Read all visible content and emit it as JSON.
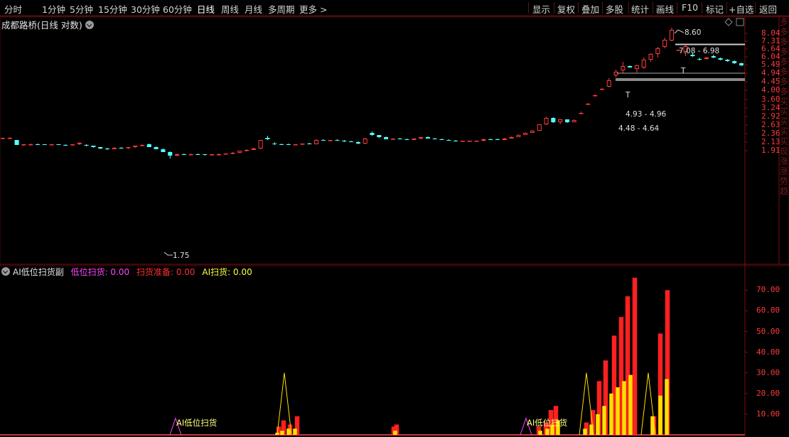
{
  "toolbar": {
    "periods": [
      "分时",
      "1分钟",
      "5分钟",
      "15分钟",
      "30分钟",
      "60分钟",
      "日线",
      "周线",
      "月线",
      "多周期",
      "更多 >"
    ],
    "active_index": 6,
    "right_buttons": [
      "显示",
      "复权",
      "叠加",
      "多股",
      "统计",
      "画线",
      "F10",
      "标记",
      "+自选",
      "返回"
    ]
  },
  "main": {
    "title": "成都路桥(日线 对数)",
    "price_ticks": [
      "8.04",
      "7.31",
      "6.64",
      "6.04",
      "5.49",
      "4.94",
      "4.45",
      "4.00",
      "3.60",
      "3.24",
      "2.92",
      "2.63",
      "2.36",
      "2.13",
      "1.91"
    ],
    "annotations": {
      "high": "8.60",
      "low": "1.75",
      "zone1": "7.08 - 6.98",
      "zone2": "4.93 - 4.96",
      "zone3": "4.48 - 4.64",
      "t1": "T",
      "t2": "T"
    }
  },
  "indicator": {
    "name": "AI低位扫货副",
    "labels": [
      {
        "text": "低位扫货: 0.00",
        "color": "#ff44ff"
      },
      {
        "text": "扫货准备: 0.00",
        "color": "#ff3030"
      },
      {
        "text": "AI扫货: 0.00",
        "color": "#ffff40"
      }
    ],
    "ticks": [
      "70.00",
      "60.00",
      "50.00",
      "40.00",
      "30.00",
      "20.00",
      "10.00"
    ],
    "markers": [
      "AI低位扫货",
      "AI低位扫货"
    ]
  },
  "sidebar_chars": "多多多多多多多多买买买买买现涨涨势趋",
  "colors": {
    "up": "#ff3b3b",
    "down": "#54ffff",
    "grid": "#7a1010",
    "yellow": "#ffe000",
    "red_bar": "#ff2020",
    "magenta": "#ff44ff"
  },
  "chart_data": {
    "type": "candlestick",
    "candles": [
      [
        2.22,
        2.25,
        2.2,
        2.24
      ],
      [
        2.24,
        2.26,
        2.23,
        2.25
      ],
      [
        2.18,
        2.19,
        2.05,
        2.06
      ],
      [
        2.06,
        2.08,
        2.04,
        2.07
      ],
      [
        2.07,
        2.09,
        2.05,
        2.08
      ],
      [
        2.08,
        2.09,
        2.06,
        2.07
      ],
      [
        2.07,
        2.08,
        2.05,
        2.06
      ],
      [
        2.06,
        2.08,
        2.05,
        2.07
      ],
      [
        2.07,
        2.08,
        2.05,
        2.06
      ],
      [
        2.06,
        2.07,
        2.04,
        2.05
      ],
      [
        2.05,
        2.08,
        2.04,
        2.07
      ],
      [
        2.07,
        2.12,
        2.06,
        2.11
      ],
      [
        2.05,
        2.07,
        2.02,
        2.03
      ],
      [
        2.03,
        2.04,
        1.99,
        2.0
      ],
      [
        2.0,
        2.01,
        1.96,
        1.97
      ],
      [
        1.97,
        1.99,
        1.93,
        1.96
      ],
      [
        1.96,
        2.0,
        1.95,
        1.99
      ],
      [
        1.99,
        2.01,
        1.97,
        1.98
      ],
      [
        1.98,
        2.01,
        1.96,
        2.0
      ],
      [
        2.0,
        2.04,
        1.99,
        2.03
      ],
      [
        2.03,
        2.07,
        2.02,
        2.06
      ],
      [
        2.08,
        2.1,
        2.0,
        2.01
      ],
      [
        2.01,
        2.02,
        1.95,
        1.96
      ],
      [
        1.96,
        1.97,
        1.88,
        1.89
      ],
      [
        1.89,
        1.9,
        1.75,
        1.8
      ],
      [
        1.8,
        1.85,
        1.79,
        1.84
      ],
      [
        1.84,
        1.86,
        1.82,
        1.83
      ],
      [
        1.83,
        1.85,
        1.82,
        1.84
      ],
      [
        1.84,
        1.85,
        1.82,
        1.83
      ],
      [
        1.83,
        1.84,
        1.81,
        1.82
      ],
      [
        1.82,
        1.84,
        1.8,
        1.83
      ],
      [
        1.83,
        1.85,
        1.82,
        1.84
      ],
      [
        1.84,
        1.86,
        1.83,
        1.85
      ],
      [
        1.85,
        1.88,
        1.84,
        1.87
      ],
      [
        1.87,
        1.92,
        1.86,
        1.91
      ],
      [
        1.91,
        1.95,
        1.9,
        1.94
      ],
      [
        1.94,
        1.98,
        1.93,
        1.97
      ],
      [
        1.97,
        2.1,
        1.96,
        2.18
      ],
      [
        2.25,
        2.3,
        2.18,
        2.2
      ],
      [
        2.1,
        2.12,
        2.06,
        2.08
      ],
      [
        2.08,
        2.1,
        2.05,
        2.07
      ],
      [
        2.07,
        2.09,
        2.05,
        2.06
      ],
      [
        2.06,
        2.08,
        2.05,
        2.07
      ],
      [
        2.07,
        2.1,
        2.06,
        2.09
      ],
      [
        2.09,
        2.11,
        2.07,
        2.08
      ],
      [
        2.08,
        2.2,
        2.07,
        2.19
      ],
      [
        2.19,
        2.21,
        2.16,
        2.17
      ],
      [
        2.17,
        2.19,
        2.15,
        2.18
      ],
      [
        2.18,
        2.2,
        2.16,
        2.17
      ],
      [
        2.17,
        2.18,
        2.13,
        2.14
      ],
      [
        2.14,
        2.16,
        2.12,
        2.13
      ],
      [
        2.13,
        2.15,
        2.08,
        2.1
      ],
      [
        2.09,
        2.25,
        2.08,
        2.22
      ],
      [
        2.38,
        2.42,
        2.3,
        2.32
      ],
      [
        2.32,
        2.33,
        2.25,
        2.26
      ],
      [
        2.26,
        2.28,
        2.2,
        2.21
      ],
      [
        2.21,
        2.23,
        2.19,
        2.22
      ],
      [
        2.22,
        2.24,
        2.2,
        2.21
      ],
      [
        2.21,
        2.22,
        2.18,
        2.19
      ],
      [
        2.19,
        2.23,
        2.18,
        2.22
      ],
      [
        2.22,
        2.27,
        2.21,
        2.26
      ],
      [
        2.26,
        2.28,
        2.22,
        2.23
      ],
      [
        2.23,
        2.25,
        2.2,
        2.21
      ],
      [
        2.21,
        2.22,
        2.18,
        2.19
      ],
      [
        2.19,
        2.2,
        2.16,
        2.17
      ],
      [
        2.17,
        2.18,
        2.15,
        2.16
      ],
      [
        2.16,
        2.17,
        2.15,
        2.16
      ],
      [
        2.16,
        2.17,
        2.15,
        2.16
      ],
      [
        2.16,
        2.17,
        2.15,
        2.16
      ],
      [
        2.16,
        2.22,
        2.15,
        2.21
      ],
      [
        2.21,
        2.23,
        2.19,
        2.2
      ],
      [
        2.2,
        2.22,
        2.18,
        2.19
      ],
      [
        2.19,
        2.24,
        2.18,
        2.23
      ],
      [
        2.23,
        2.28,
        2.22,
        2.27
      ],
      [
        2.27,
        2.34,
        2.26,
        2.33
      ],
      [
        2.33,
        2.4,
        2.32,
        2.39
      ],
      [
        2.39,
        2.46,
        2.38,
        2.45
      ],
      [
        2.45,
        2.65,
        2.44,
        2.64
      ],
      [
        2.64,
        2.9,
        2.62,
        2.86
      ],
      [
        2.86,
        2.88,
        2.7,
        2.72
      ],
      [
        2.72,
        2.82,
        2.65,
        2.8
      ],
      [
        2.8,
        2.82,
        2.7,
        2.72
      ],
      [
        2.72,
        2.8,
        2.71,
        2.79
      ],
      [
        3.05,
        3.08,
        3.03,
        3.05
      ],
      [
        3.4,
        3.42,
        3.38,
        3.4
      ],
      [
        3.78,
        3.8,
        3.76,
        3.78
      ],
      [
        4.1,
        4.12,
        4.08,
        4.1
      ],
      [
        4.2,
        4.65,
        4.15,
        4.55
      ],
      [
        4.8,
        5.15,
        4.7,
        5.02
      ],
      [
        5.1,
        5.7,
        4.93,
        5.4
      ],
      [
        5.4,
        5.45,
        5.3,
        5.32
      ],
      [
        5.2,
        5.5,
        5.0,
        5.45
      ],
      [
        5.3,
        6.0,
        5.2,
        5.85
      ],
      [
        5.85,
        6.3,
        5.7,
        6.25
      ],
      [
        6.25,
        6.8,
        6.0,
        6.7
      ],
      [
        6.8,
        7.6,
        6.7,
        7.45
      ],
      [
        7.4,
        8.6,
        7.3,
        8.38
      ],
      [
        6.6,
        6.61,
        6.59,
        6.6
      ],
      [
        6.4,
        7.0,
        6.1,
        6.9
      ],
      [
        6.2,
        6.3,
        6.05,
        6.1
      ],
      [
        5.9,
        6.0,
        5.8,
        5.85
      ],
      [
        5.9,
        6.05,
        5.85,
        6.0
      ],
      [
        6.1,
        6.2,
        5.95,
        6.0
      ],
      [
        5.95,
        5.99,
        5.8,
        5.85
      ],
      [
        5.85,
        5.9,
        5.7,
        5.75
      ],
      [
        5.75,
        5.8,
        5.55,
        5.6
      ],
      [
        5.6,
        5.65,
        5.4,
        5.45
      ]
    ],
    "ind_fill": [
      [
        388,
        1,
        0
      ],
      [
        394,
        3,
        0
      ],
      [
        397,
        1,
        0
      ],
      [
        404,
        2,
        0
      ],
      [
        411,
        2,
        0
      ],
      [
        418,
        9,
        0
      ],
      [
        556,
        2,
        0
      ],
      [
        763,
        1,
        0
      ],
      [
        772,
        2,
        0
      ],
      [
        779,
        4,
        0
      ],
      [
        823,
        2,
        0
      ],
      [
        830,
        8,
        0
      ],
      [
        839,
        13,
        0
      ],
      [
        846,
        19,
        0
      ],
      [
        854,
        22,
        0
      ],
      [
        864,
        35,
        0
      ],
      [
        872,
        23,
        0
      ],
      [
        878,
        20,
        0
      ],
      [
        887,
        24,
        0
      ],
      [
        902,
        6,
        0
      ],
      [
        920,
        12,
        0
      ],
      [
        934,
        19,
        0
      ],
      [
        942,
        23,
        0
      ]
    ],
    "ind_red": [
      [
        392,
        4
      ],
      [
        399,
        7
      ],
      [
        408,
        5
      ],
      [
        418,
        9
      ],
      [
        554,
        4
      ],
      [
        558,
        5
      ],
      [
        758,
        4
      ],
      [
        768,
        6
      ],
      [
        775,
        12
      ],
      [
        782,
        14
      ],
      [
        825,
        6
      ],
      [
        834,
        12
      ],
      [
        843,
        26
      ],
      [
        852,
        36
      ],
      [
        864,
        48
      ],
      [
        874,
        57
      ],
      [
        883,
        67
      ],
      [
        893,
        76
      ],
      [
        920,
        9
      ],
      [
        929,
        49
      ],
      [
        939,
        70
      ]
    ],
    "ind_yellow": [
      [
        390,
        1
      ],
      [
        397,
        2
      ],
      [
        406,
        3
      ],
      [
        415,
        3
      ],
      [
        556,
        2
      ],
      [
        760,
        2
      ],
      [
        770,
        3
      ],
      [
        777,
        5
      ],
      [
        785,
        7
      ],
      [
        823,
        3
      ],
      [
        832,
        5
      ],
      [
        841,
        10
      ],
      [
        850,
        14
      ],
      [
        860,
        20
      ],
      [
        869,
        23
      ],
      [
        878,
        26
      ],
      [
        887,
        29
      ],
      [
        918,
        9
      ],
      [
        929,
        19
      ],
      [
        938,
        27
      ]
    ],
    "low_spikes": [
      [
        247,
        8
      ],
      [
        740,
        8
      ]
    ],
    "prep_spikes": [
      [
        400,
        30
      ],
      [
        825,
        30
      ],
      [
        912,
        30
      ]
    ]
  }
}
